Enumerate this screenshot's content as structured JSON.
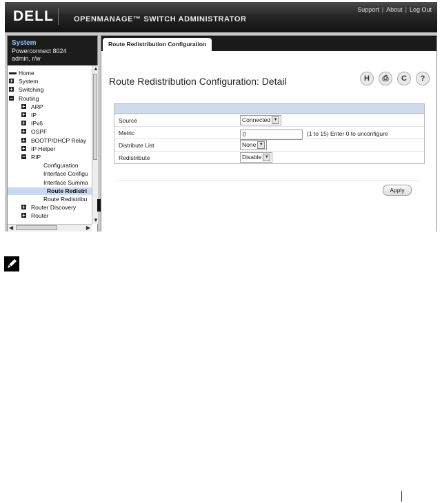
{
  "header": {
    "logo": "DELL",
    "app_title": "OPENMANAGE™ SWITCH ADMINISTRATOR",
    "links": [
      "Support",
      "About",
      "Log Out"
    ]
  },
  "system": {
    "title": "System",
    "model": "Powerconnect 8024",
    "user": "admin, r/w"
  },
  "tree": [
    {
      "label": "Home",
      "level": 0,
      "icon": "home-icon"
    },
    {
      "label": "System",
      "level": 0,
      "icon": "expand-icon"
    },
    {
      "label": "Switching",
      "level": 0,
      "icon": "expand-icon"
    },
    {
      "label": "Routing",
      "level": 0,
      "icon": "collapse-icon"
    },
    {
      "label": "ARP",
      "level": 1,
      "icon": "expand-icon"
    },
    {
      "label": "IP",
      "level": 1,
      "icon": "expand-icon"
    },
    {
      "label": "IPv6",
      "level": 1,
      "icon": "expand-icon"
    },
    {
      "label": "OSPF",
      "level": 1,
      "icon": "expand-icon"
    },
    {
      "label": "BOOTP/DHCP Relay",
      "level": 1,
      "icon": "expand-icon"
    },
    {
      "label": "IP Helper",
      "level": 1,
      "icon": "expand-icon"
    },
    {
      "label": "RIP",
      "level": 1,
      "icon": "collapse-icon"
    },
    {
      "label": "Configuration",
      "level": 2,
      "icon": ""
    },
    {
      "label": "Interface Configu",
      "level": 2,
      "icon": ""
    },
    {
      "label": "Interface Summa",
      "level": 2,
      "icon": ""
    },
    {
      "label": "Route Redistri",
      "level": 2,
      "icon": "",
      "selected": true
    },
    {
      "label": "Route Redistribu",
      "level": 2,
      "icon": ""
    },
    {
      "label": "Router Discovery",
      "level": 1,
      "icon": "expand-icon"
    },
    {
      "label": "Router",
      "level": 1,
      "icon": "expand-icon"
    }
  ],
  "tab": {
    "label": "Route Redistribution Configuration"
  },
  "page": {
    "title": "Route Redistribution Configuration: Detail"
  },
  "toolbar": {
    "save_glyph": "H",
    "print_glyph": "⎙",
    "refresh_glyph": "C",
    "help_glyph": "?"
  },
  "form": {
    "source_label": "Source",
    "source_value": "Connected",
    "metric_label": "Metric",
    "metric_value": "0",
    "metric_hint": "(1 to 15) Enter 0 to unconfigure",
    "distribute_label": "Distribute List",
    "distribute_value": "None",
    "redistribute_label": "Redistribute",
    "redistribute_value": "Disable"
  },
  "apply_label": "Apply"
}
